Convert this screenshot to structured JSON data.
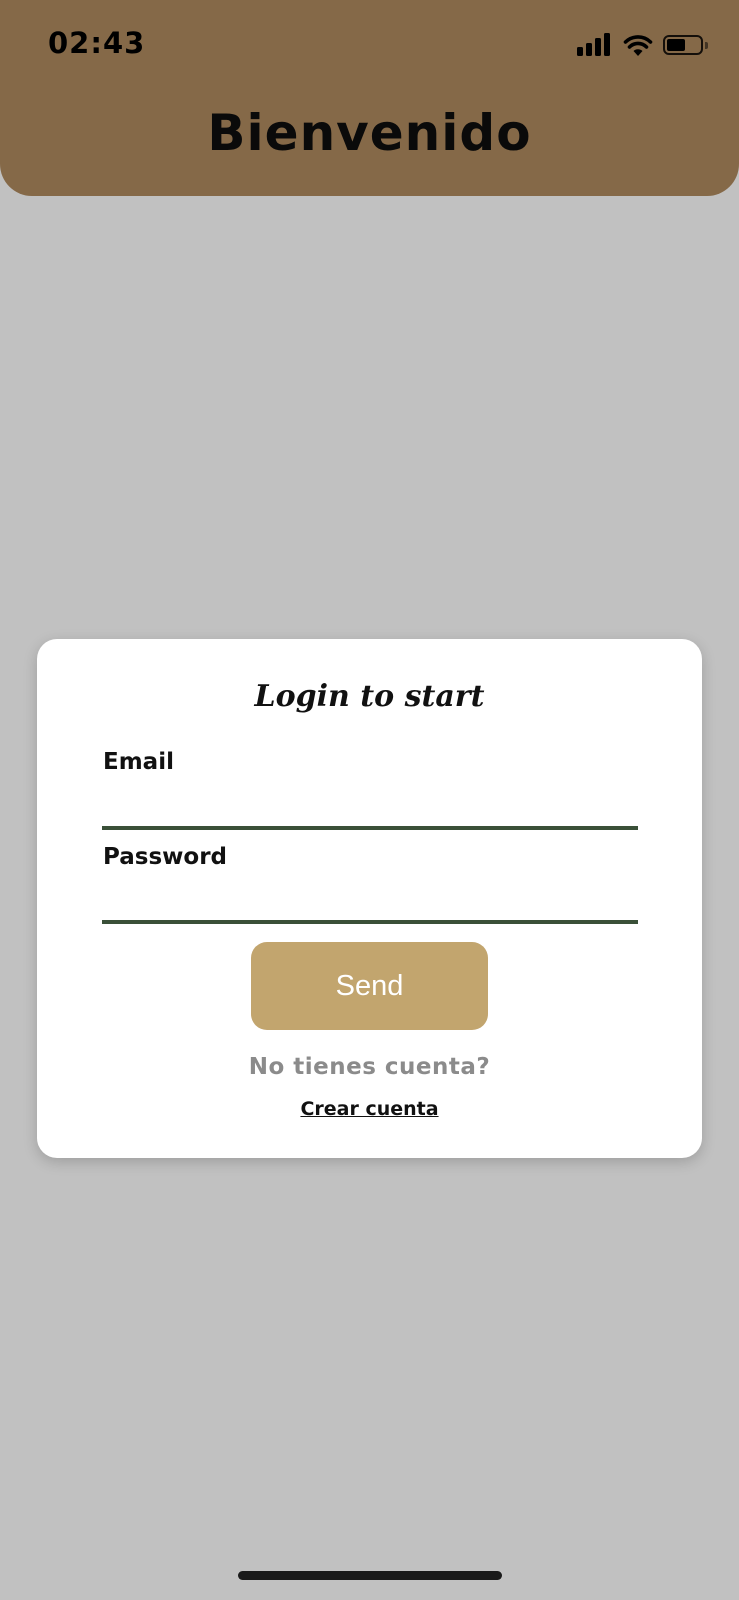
{
  "status_bar": {
    "time": "02:43",
    "icons": [
      "signal-icon",
      "wifi-icon",
      "battery-icon"
    ],
    "battery_level": 0.55
  },
  "header": {
    "title": "Bienvenido"
  },
  "login_card": {
    "title": "Login to start",
    "email_label": "Email",
    "email_value": "",
    "password_label": "Password",
    "password_value": "",
    "send_label": "Send",
    "no_account_text": "No tienes cuenta?",
    "create_account_label": "Crear cuenta"
  },
  "colors": {
    "header_bg": "#856948",
    "page_bg": "#c1c1c1",
    "button_bg": "#c2a56e",
    "input_underline": "#3a5038",
    "muted_text": "#8b8b8b"
  }
}
